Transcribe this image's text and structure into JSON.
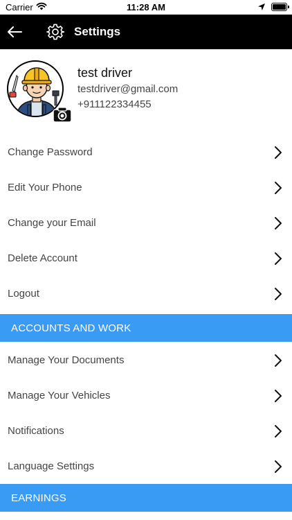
{
  "status_bar": {
    "carrier": "Carrier",
    "time": "11:28 AM"
  },
  "header": {
    "title": "Settings"
  },
  "profile": {
    "name": "test driver",
    "email": "testdriver@gmail.com",
    "phone": "+911122334455"
  },
  "account_items": [
    {
      "label": "Change Password"
    },
    {
      "label": "Edit Your Phone"
    },
    {
      "label": "Change your Email"
    },
    {
      "label": "Delete Account"
    },
    {
      "label": "Logout"
    }
  ],
  "sections": {
    "accounts_and_work": "ACCOUNTS AND WORK",
    "earnings": "EARNINGS"
  },
  "work_items": [
    {
      "label": "Manage Your Documents"
    },
    {
      "label": "Manage Your Vehicles"
    },
    {
      "label": "Notifications"
    },
    {
      "label": "Language Settings"
    }
  ],
  "colors": {
    "header_bg": "#000000",
    "section_bg": "#3a9bf5",
    "text": "#444444"
  },
  "icons": [
    "wifi-icon",
    "location-arrow-icon",
    "battery-icon",
    "back-arrow-icon",
    "gear-icon",
    "camera-icon",
    "chevron-right-icon"
  ]
}
